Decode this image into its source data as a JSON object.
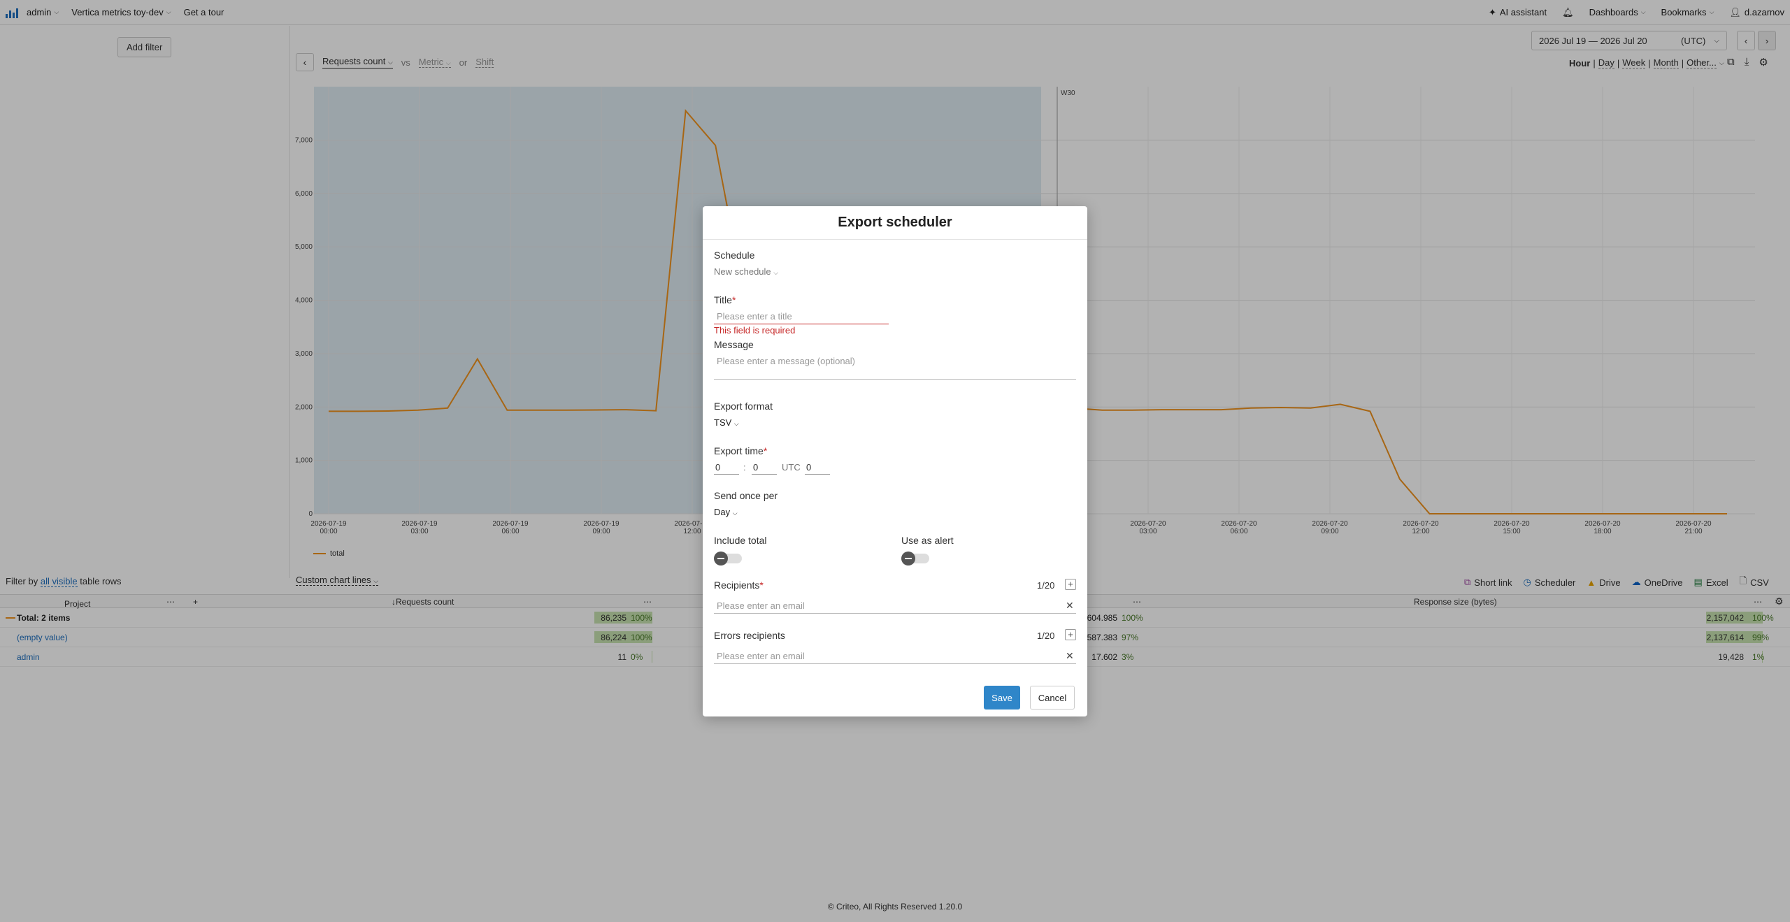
{
  "topbar": {
    "user_menu": "admin",
    "project_menu": "Vertica metrics toy-dev",
    "tour": "Get a tour",
    "ai_assistant": "AI assistant",
    "dashboards": "Dashboards",
    "bookmarks": "Bookmarks",
    "username": "d.azarnov"
  },
  "filters": {
    "add_filter": "Add filter"
  },
  "chart_header": {
    "metric": "Requests count",
    "vs": "vs",
    "metric_placeholder": "Metric",
    "or": "or",
    "shift": "Shift"
  },
  "date_range": {
    "label": "2026 Jul 19 — 2026 Jul 20",
    "tz": "(UTC)"
  },
  "granularity": [
    "Hour",
    "Day",
    "Week",
    "Month",
    "Other..."
  ],
  "chart_data": {
    "type": "line",
    "series": [
      {
        "name": "total",
        "values": [
          1920,
          1920,
          1925,
          1940,
          1980,
          2900,
          1940,
          1940,
          1940,
          1945,
          1950,
          1930,
          7550,
          6900,
          4000,
          3000,
          2500,
          2100,
          1980,
          1960,
          1950,
          1960,
          1950,
          1960,
          1950,
          1980,
          1940,
          1940,
          1950,
          1950,
          1950,
          1980,
          1990,
          1980,
          2050,
          1920,
          650,
          0,
          0,
          0,
          0,
          0,
          0,
          0,
          0,
          0,
          0,
          0
        ]
      }
    ],
    "ylim": [
      0,
      8000
    ],
    "y_ticks": [
      "0",
      "1,000",
      "2,000",
      "3,000",
      "4,000",
      "5,000",
      "6,000",
      "7,000"
    ],
    "x_ticks": [
      {
        "date": "2026-07-19",
        "time": "00:00"
      },
      {
        "date": "2026-07-19",
        "time": "03:00"
      },
      {
        "date": "2026-07-19",
        "time": "06:00"
      },
      {
        "date": "2026-07-19",
        "time": "09:00"
      },
      {
        "date": "2026-07-19",
        "time": "12:00"
      },
      {
        "date": "2026-07-20",
        "time": "03:00"
      },
      {
        "date": "2026-07-20",
        "time": "06:00"
      },
      {
        "date": "2026-07-20",
        "time": "09:00"
      },
      {
        "date": "2026-07-20",
        "time": "12:00"
      },
      {
        "date": "2026-07-20",
        "time": "15:00"
      },
      {
        "date": "2026-07-20",
        "time": "18:00"
      },
      {
        "date": "2026-07-20",
        "time": "21:00"
      }
    ],
    "week_label": "W30",
    "line_color": "#f0921e",
    "highlight_color": "#c9dde9"
  },
  "legend": {
    "series": "total"
  },
  "table_toolbar": {
    "filter_by": "Filter by",
    "all_visible": "all visible",
    "table_rows": "table rows",
    "custom_chart_lines": "Custom chart lines",
    "exports": [
      "Short link",
      "Scheduler",
      "Drive",
      "OneDrive",
      "Excel",
      "CSV"
    ]
  },
  "table": {
    "headers": {
      "project": "Project",
      "requests": "↓Requests count",
      "response_size": "Response size (bytes)"
    },
    "rows": [
      {
        "name": "Total: 2 items",
        "requests": "86,235",
        "requests_pct": "100%",
        "mid": "604.985",
        "mid_pct": "100%",
        "size": "2,157,042",
        "size_pct": "100%",
        "bar": 1.0
      },
      {
        "name": "(empty value)",
        "requests": "86,224",
        "requests_pct": "100%",
        "mid": "587.383",
        "mid_pct": "97%",
        "size": "2,137,614",
        "size_pct": "99%",
        "bar": 1.0
      },
      {
        "name": "admin",
        "requests": "11",
        "requests_pct": "0%",
        "mid": "17.602",
        "mid_pct": "3%",
        "size": "19,428",
        "size_pct": "1%",
        "bar": 0.0
      }
    ]
  },
  "footer": "© Criteo, All Rights Reserved 1.20.0",
  "modal": {
    "title": "Export scheduler",
    "schedule_label": "Schedule",
    "schedule_value": "New schedule",
    "title_label": "Title",
    "title_placeholder": "Please enter a title",
    "title_error": "This field is required",
    "message_label": "Message",
    "message_placeholder": "Please enter a message (optional)",
    "format_label": "Export format",
    "format_value": "TSV",
    "time_label": "Export time",
    "time_hour": "0",
    "time_minute": "0",
    "time_tz": "UTC",
    "time_offset": "0",
    "send_label": "Send once per",
    "send_value": "Day",
    "include_total": "Include total",
    "use_as_alert": "Use as alert",
    "recipients_label": "Recipients",
    "recipients_count": "1/20",
    "email_placeholder": "Please enter an email",
    "errors_label": "Errors recipients",
    "errors_count": "1/20",
    "save": "Save",
    "cancel": "Cancel"
  }
}
